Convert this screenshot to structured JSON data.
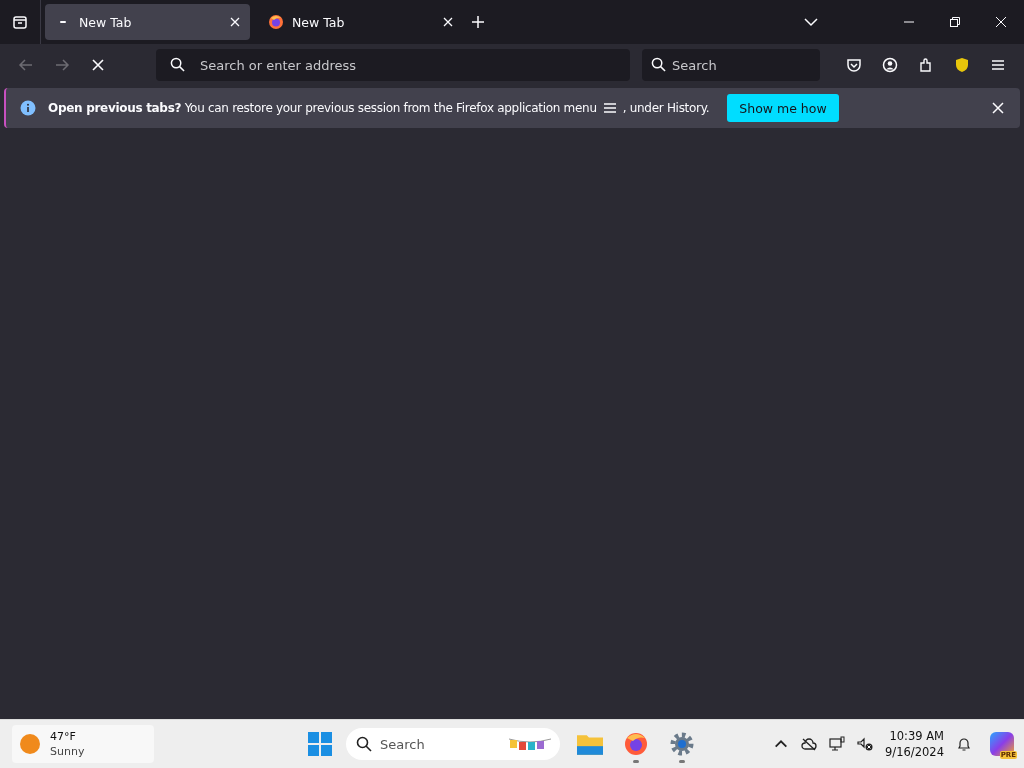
{
  "tabs": [
    {
      "label": "New Tab",
      "selected": true,
      "loading": true
    },
    {
      "label": "New Tab",
      "selected": false,
      "loading": false
    }
  ],
  "toolbar": {
    "address": {
      "placeholder": "Search or enter address"
    },
    "search": {
      "placeholder": "Search"
    }
  },
  "notification": {
    "message": "Open previous tabs? You can restore your previous session from the Firefox application menu",
    "suffix": ", under History.",
    "button": "Show me how"
  },
  "taskbar": {
    "weather": {
      "temperature": "47°F",
      "condition": "Sunny"
    },
    "search": {
      "placeholder": "Search"
    },
    "apps": [
      {
        "kind": "folder",
        "running": false
      },
      {
        "kind": "firefox",
        "running": true
      },
      {
        "kind": "settings",
        "running": true
      }
    ],
    "time": "10:39 AM",
    "date": "9/16/2024",
    "copilot_badge": "PRE"
  }
}
